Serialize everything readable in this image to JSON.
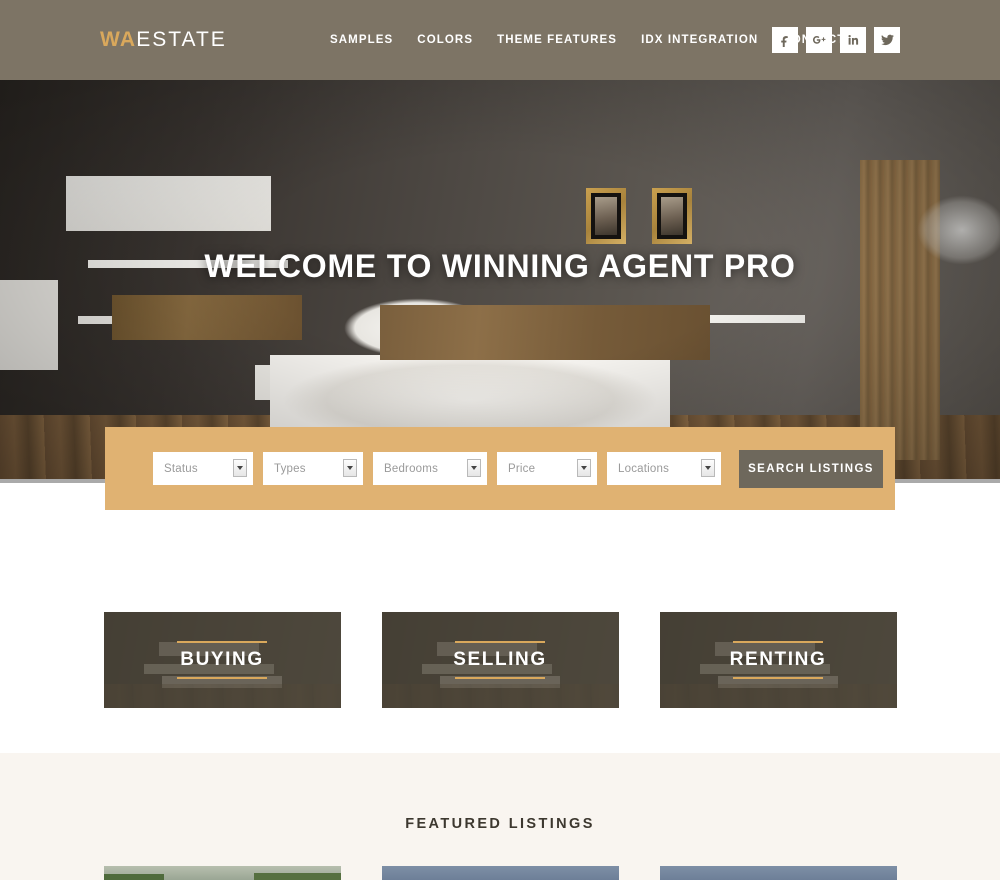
{
  "header": {
    "logo": {
      "accent": "WA",
      "rest": "ESTATE"
    },
    "nav": [
      {
        "label": "SAMPLES"
      },
      {
        "label": "COLORS"
      },
      {
        "label": "THEME FEATURES"
      },
      {
        "label": "IDX INTEGRATION"
      },
      {
        "label": "CONTACT"
      }
    ],
    "social": [
      {
        "name": "facebook-icon",
        "label": "f"
      },
      {
        "name": "google-plus-icon",
        "label": "g+"
      },
      {
        "name": "linkedin-icon",
        "label": "in"
      },
      {
        "name": "twitter-icon",
        "label": "twitter"
      }
    ],
    "bg_color": "#7d7465",
    "accent_color": "#d9a85c"
  },
  "hero": {
    "title": "WELCOME TO WINNING AGENT PRO",
    "image_alt": "Modern bedroom interior with white bed, floating shelves and gold picture frames"
  },
  "search": {
    "bg_color": "#e0b272",
    "fields": [
      {
        "name": "status",
        "label": "Status"
      },
      {
        "name": "types",
        "label": "Types"
      },
      {
        "name": "bedrooms",
        "label": "Bedrooms"
      },
      {
        "name": "price",
        "label": "Price"
      },
      {
        "name": "locations",
        "label": "Locations"
      }
    ],
    "button_label": "SEARCH LISTINGS",
    "button_color": "#6e685c"
  },
  "categories": [
    {
      "label": "BUYING"
    },
    {
      "label": "SELLING"
    },
    {
      "label": "RENTING"
    }
  ],
  "featured": {
    "title": "FEATURED LISTINGS",
    "bg_color": "#f9f5f0",
    "listings": [
      {
        "name": "listing-1"
      },
      {
        "name": "listing-2"
      },
      {
        "name": "listing-3"
      }
    ]
  }
}
